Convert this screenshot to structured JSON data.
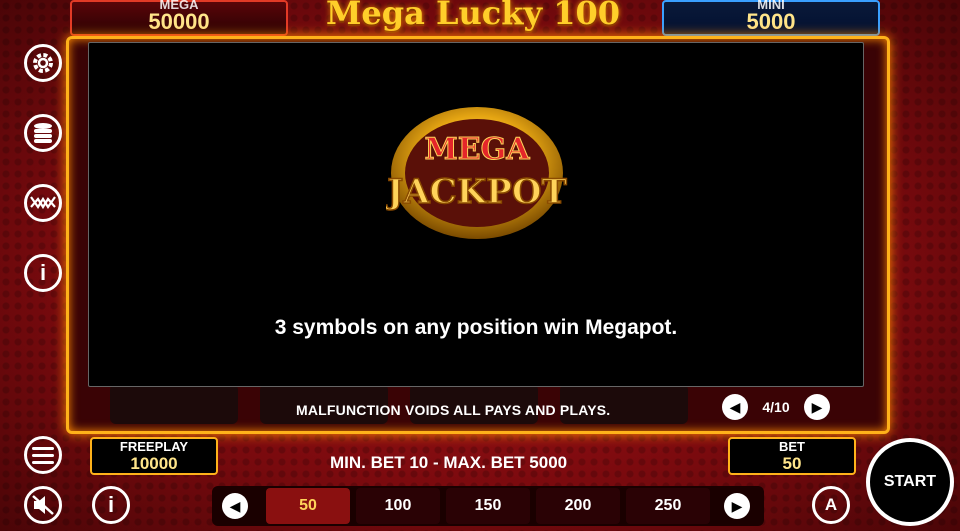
{
  "jackpots": {
    "mega": {
      "label": "MEGA",
      "value": "50000"
    },
    "mini": {
      "label": "MINI",
      "value": "5000"
    }
  },
  "game_title": "Mega Lucky 100",
  "sidebar": {
    "icons": [
      "gear-icon",
      "coins-icon",
      "paylines-icon",
      "info-icon"
    ]
  },
  "modal": {
    "logo": {
      "top": "MEGA",
      "bottom": "JACKPOT"
    },
    "text": "3 symbols on any position win Megapot."
  },
  "info_strip": {
    "notice": "MALFUNCTION VOIDS ALL PAYS AND PLAYS.",
    "page": "4/10"
  },
  "freeplay": {
    "label": "FREEPLAY",
    "value": "10000"
  },
  "bet": {
    "label": "BET",
    "value": "50"
  },
  "bet_range": "MIN. BET 10 - MAX. BET 5000",
  "bet_options": [
    "50",
    "100",
    "150",
    "200",
    "250"
  ],
  "selected_bet": "50",
  "start_label": "START",
  "colors": {
    "gold": "#ffb21a",
    "red": "#b0141a",
    "mini_blue": "#3aa0ff"
  }
}
